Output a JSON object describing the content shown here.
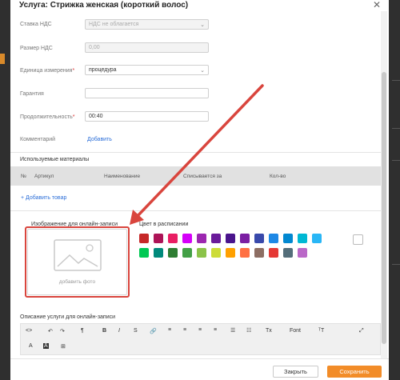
{
  "dialog": {
    "title": "Услуга: Стрижка женская (короткий волос)",
    "close_glyph": "✕"
  },
  "form": {
    "vat_rate": {
      "label": "Ставка НДС",
      "value": "НДС не облагается"
    },
    "vat_amount": {
      "label": "Размер НДС",
      "value": "0,00"
    },
    "unit": {
      "label": "Единица измерения",
      "required_mark": "*",
      "value": "процедура"
    },
    "warranty": {
      "label": "Гарантия",
      "value": ""
    },
    "duration": {
      "label": "Продолжительность",
      "required_mark": "*",
      "value": "00:40"
    },
    "comment": {
      "label": "Комментарий",
      "link": "Добавить"
    }
  },
  "materials": {
    "title": "Используемые материалы",
    "columns": [
      "№",
      "Артикул",
      "Наименование",
      "Списывается за",
      "Кол-во"
    ],
    "add_link": "+ Добавить товар"
  },
  "image": {
    "title": "Изображение для онлайн-записи",
    "placeholder": "добавить фото"
  },
  "schedule_color": {
    "title": "Цвет в расписании",
    "row1": [
      "#c62828",
      "#ad1457",
      "#e91e63",
      "#d500f9",
      "#9c27b0",
      "#6a1b9a",
      "#4a148c",
      "#7b1fa2",
      "#3949ab",
      "#1e88e5",
      "#0288d1",
      "#00b8d4",
      "#29b6f6"
    ],
    "row2": [
      "#00c853",
      "#00897b",
      "#2e7d32",
      "#43a047",
      "#8bc34a",
      "#cddc39",
      "#ffa000",
      "#ff7043",
      "#8d6e63",
      "#e53935",
      "#546e7a",
      "#ba68c8"
    ]
  },
  "description": {
    "title": "Описание услуги для онлайн-записи",
    "toolbar": {
      "code": "<>",
      "undo": "↶",
      "redo": "↷",
      "format": "¶",
      "bold": "B",
      "italic": "I",
      "strike": "S",
      "link": "🔗",
      "align_left": "≡",
      "align_center": "≡",
      "align_right": "≡",
      "justify": "≡",
      "bullets": "☰",
      "numbers": "☷",
      "clear": "Tx",
      "font": "Font",
      "font_size": "ᵀT",
      "fullscreen": "⤢",
      "text_color": "A",
      "bg_color": "A",
      "insert_image": "⊞"
    }
  },
  "footer": {
    "close": "Закрыть",
    "save": "Сохранить"
  },
  "colors": {
    "accent": "#f28c28",
    "annotation": "#d9453d",
    "link": "#2b6ed8"
  }
}
